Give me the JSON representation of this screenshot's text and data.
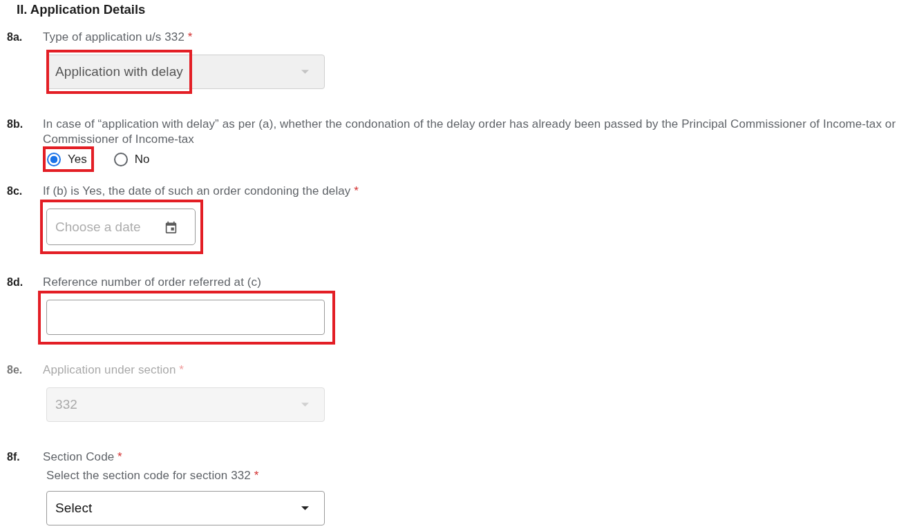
{
  "section_title": "II. Application Details",
  "questions": [
    {
      "number": "8a.",
      "label": "Type of application u/s 332",
      "required_mark": "*",
      "disabled": false,
      "kind": "select",
      "field": {
        "value": "Application with delay",
        "readonly": true,
        "highlighted": true
      }
    },
    {
      "number": "8b.",
      "label": "In case of “application with delay” as per (a), whether the condonation of the delay order has already been passed by the Principal Commissioner of Income-tax or Commissioner of Income-tax",
      "disabled": false,
      "kind": "radio",
      "options": [
        {
          "label": "Yes",
          "selected": true,
          "highlighted": true
        },
        {
          "label": "No",
          "selected": false,
          "highlighted": false
        }
      ]
    },
    {
      "number": "8c.",
      "label": "If (b) is Yes, the date of such an order condoning the delay",
      "required_mark": "*",
      "disabled": false,
      "kind": "date",
      "field": {
        "placeholder": "Choose a date",
        "highlighted": true
      }
    },
    {
      "number": "8d.",
      "label": "Reference number of order referred at (c)",
      "disabled": false,
      "kind": "text",
      "field": {
        "highlighted": true
      }
    },
    {
      "number": "8e.",
      "label": "Application under section",
      "required_mark": "*",
      "disabled": true,
      "kind": "select",
      "field": {
        "value": "332",
        "highlighted": false
      }
    },
    {
      "number": "8f.",
      "label": "Section Code",
      "required_mark": "*",
      "disabled": false,
      "kind": "select",
      "sublabel": "Select the section code for section 332",
      "sublabel_mark": "*",
      "field": {
        "value": "Select",
        "readonly": false,
        "highlighted": false
      }
    }
  ]
}
